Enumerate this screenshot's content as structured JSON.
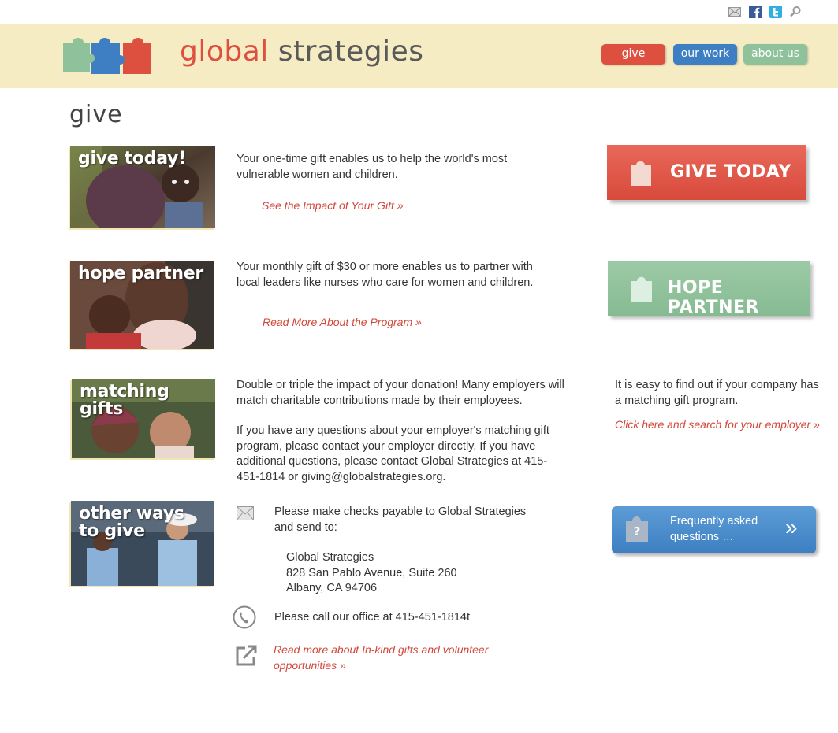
{
  "top_icons": [
    "mail-icon",
    "facebook-icon",
    "twitter-icon",
    "search-icon"
  ],
  "logo": {
    "word1": "global",
    "word2": "strategies"
  },
  "nav": {
    "give": "give",
    "our_work": "our work",
    "about_us": "about us"
  },
  "page_title": "give",
  "sections": {
    "give_today": {
      "photo_label": "give today!",
      "text": "Your one-time gift enables us to help the world's most vulnerable women and children.",
      "link": "See the Impact of Your Gift »",
      "button": "GIVE TODAY"
    },
    "hope_partner": {
      "photo_label": "hope partner",
      "text": "Your monthly gift of $30 or more enables us to partner with local leaders like nurses who care for women and children.",
      "link": "Read More About the Program »",
      "button": "HOPE PARTNER"
    },
    "matching": {
      "photo_label": "matching gifts",
      "text1": "Double or triple the impact of your donation! Many employers will match charitable contributions made by their employees.",
      "text2": "If you have any questions about your employer's matching gift program, please contact your employer directly. If you have additional questions, please contact Global Strategies at 415-451-1814 or giving@globalstrategies.org.",
      "side_text": "It is easy to  find out if your company has a matching gift program.",
      "side_link": "Click here and search for your employer »"
    },
    "other": {
      "photo_label_1": "other ways",
      "photo_label_2": "to give",
      "checks": "Please make checks payable to Global Strategies and send to:",
      "address_1": "Global Strategies",
      "address_2": "828 San Pablo Avenue, Suite 260",
      "address_3": "Albany, CA 94706",
      "call": "Please call our office at 415-451-1814t",
      "inkind_link": "Read more about In-kind gifts and volunteer opportunities  »",
      "faq": "Frequently asked questions …",
      "faq_chevron": "»"
    }
  },
  "colors": {
    "red": "#dd5040",
    "blue": "#3d7fc2",
    "green": "#8fc29b",
    "header_bg": "#f6ecc4",
    "link": "#d2473a"
  }
}
